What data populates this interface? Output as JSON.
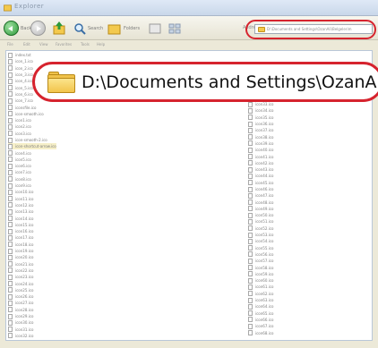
{
  "window": {
    "title": "Explorer"
  },
  "toolbar": {
    "back_label": "Back",
    "search_label": "Search",
    "folders_label": "Folders",
    "address_label": "Address",
    "address_value": "D:\\Documents and Settings\\OzanAli\\Belgelerim"
  },
  "menu": {
    "items": [
      "File",
      "Edit",
      "View",
      "Favorites",
      "Tools",
      "Help"
    ]
  },
  "callout": {
    "path": "D:\\Documents and Settings\\OzanAli\\("
  },
  "files": {
    "left": [
      "index.txt",
      "icon_1.ico",
      "icon_2.ico",
      "icon_3.ico",
      "icon_4.ico",
      "icon_5.ico",
      "icon_6.ico",
      "icon_7.ico",
      "iconsfile.ico",
      "icon-smooth.ico",
      "icon1.ico",
      "icon2.ico",
      "icon3.ico",
      "icon-smooth-2.ico",
      "icon-shortcut-arrow.ico",
      "icon4.ico",
      "icon5.ico",
      "icon6.ico",
      "icon7.ico",
      "icon8.ico",
      "icon9.ico",
      "icon10.ico",
      "icon11.ico",
      "icon12.ico",
      "icon13.ico",
      "icon14.ico",
      "icon15.ico",
      "icon16.ico",
      "icon17.ico",
      "icon18.ico",
      "icon19.ico",
      "icon20.ico",
      "icon21.ico",
      "icon22.ico",
      "icon23.ico",
      "icon24.ico",
      "icon25.ico",
      "icon26.ico",
      "icon27.ico",
      "icon28.ico",
      "icon29.ico",
      "icon30.ico",
      "icon31.ico",
      "icon32.ico"
    ],
    "right": [
      "icon33.ico",
      "icon34.ico",
      "icon35.ico",
      "icon36.ico",
      "icon37.ico",
      "icon38.ico",
      "icon39.ico",
      "icon40.ico",
      "icon41.ico",
      "icon42.ico",
      "icon43.ico",
      "icon44.ico",
      "icon45.ico",
      "icon46.ico",
      "icon47.ico",
      "icon48.ico",
      "icon49.ico",
      "icon50.ico",
      "icon51.ico",
      "icon52.ico",
      "icon53.ico",
      "icon54.ico",
      "icon55.ico",
      "icon56.ico",
      "icon57.ico",
      "icon58.ico",
      "icon59.ico",
      "icon60.ico",
      "icon61.ico",
      "icon62.ico",
      "icon63.ico",
      "icon64.ico",
      "icon65.ico",
      "icon66.ico",
      "icon67.ico",
      "icon68.ico"
    ]
  }
}
